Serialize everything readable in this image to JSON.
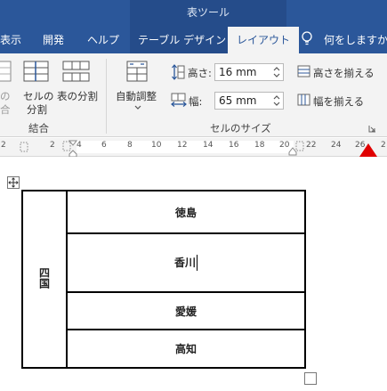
{
  "ribbon": {
    "context_group": "表ツール",
    "tabs": [
      "表示",
      "開発",
      "ヘルプ",
      "テーブル デザイン",
      "レイアウト"
    ],
    "active_tab": "レイアウト",
    "tell_me": "何をしますか",
    "accent_color": "#2b579a"
  },
  "merge_group": {
    "merge_cells_partial": [
      "の",
      "合"
    ],
    "split_cells": [
      "セルの",
      "分割"
    ],
    "split_table": "表の分割",
    "title": "結合"
  },
  "cell_size_group": {
    "autofit": "自動調整",
    "height_label": "高さ:",
    "height_value": "16 mm",
    "width_label": "幅:",
    "width_value": "65 mm",
    "distribute_rows": "高さを揃える",
    "distribute_columns": "幅を揃える",
    "title": "セルのサイズ"
  },
  "ruler": {
    "numbers": [
      "2",
      "2",
      "4",
      "6",
      "8",
      "10",
      "12",
      "14",
      "16",
      "18",
      "20",
      "22",
      "24",
      "26",
      "2"
    ]
  },
  "table": {
    "merged_cell": "四国",
    "rows": [
      "徳島",
      "香川",
      "愛媛",
      "高知"
    ]
  }
}
